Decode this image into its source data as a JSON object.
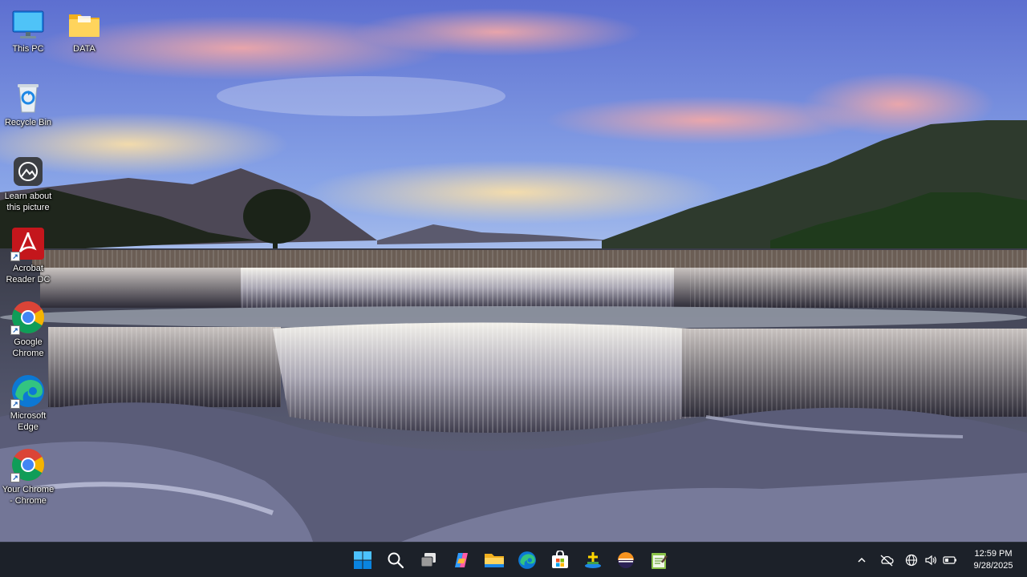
{
  "desktop": {
    "icons": [
      {
        "label": "This PC",
        "icon": "monitor-icon"
      },
      {
        "label": "DATA",
        "icon": "folder-icon"
      },
      {
        "label": "Recycle Bin",
        "icon": "recycle-bin-icon"
      },
      {
        "label": "Learn about\nthis picture",
        "icon": "camera-icon"
      },
      {
        "label": "Acrobat\nReader DC",
        "icon": "acrobat-icon"
      },
      {
        "label": "Google\nChrome",
        "icon": "chrome-icon"
      },
      {
        "label": "Microsoft\nEdge",
        "icon": "edge-icon"
      },
      {
        "label": "Your Chrome\n- Chrome",
        "icon": "chrome-icon"
      }
    ]
  },
  "taskbar": {
    "apps": [
      {
        "name": "Start",
        "icon": "windows-start-icon"
      },
      {
        "name": "Search",
        "icon": "search-icon"
      },
      {
        "name": "Task View",
        "icon": "task-view-icon"
      },
      {
        "name": "Copilot",
        "icon": "copilot-icon"
      },
      {
        "name": "File Explorer",
        "icon": "folder-icon"
      },
      {
        "name": "Microsoft Edge",
        "icon": "edge-icon"
      },
      {
        "name": "Microsoft Store",
        "icon": "store-icon"
      },
      {
        "name": "App",
        "icon": "ladder-app-icon"
      },
      {
        "name": "App",
        "icon": "eclipse-icon"
      },
      {
        "name": "Notepad",
        "icon": "notepad-icon"
      }
    ],
    "tray": {
      "icons": [
        "chevron-up-icon",
        "network-off-icon",
        "globe-icon",
        "speaker-icon",
        "battery-icon"
      ],
      "time": "12:59 PM",
      "date": "9/28/2025"
    }
  },
  "colors": {
    "taskbar_bg": "#1c2129",
    "accent": "#0078d4"
  }
}
